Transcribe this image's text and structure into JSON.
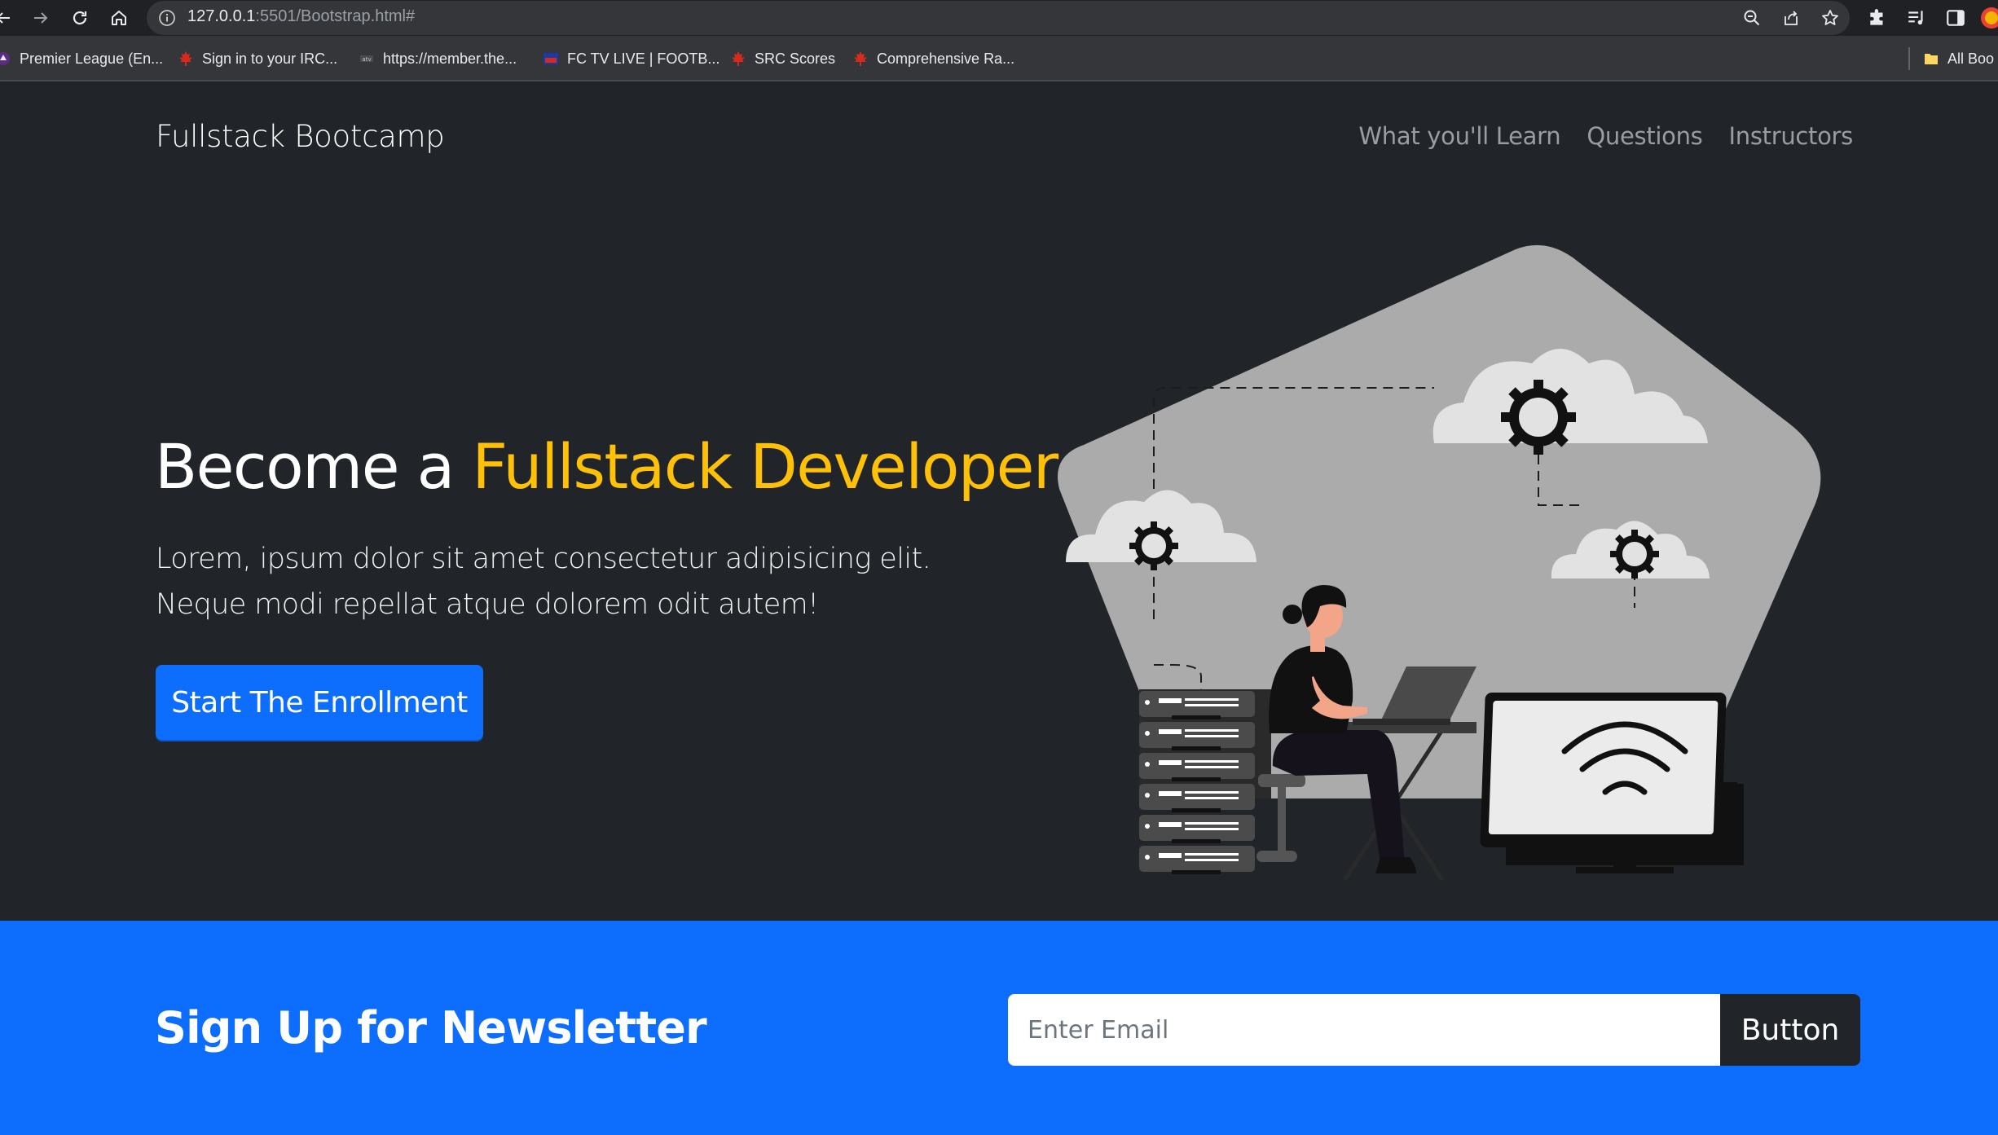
{
  "browser": {
    "url_host": "127.0.0.1",
    "url_path": ":5501/Bootstrap.html#",
    "bookmarks": [
      {
        "label": "Premier League (En..."
      },
      {
        "label": "Sign in to your IRC..."
      },
      {
        "label": "https://member.the..."
      },
      {
        "label": "FC TV LIVE | FOOTB..."
      },
      {
        "label": "SRC Scores"
      },
      {
        "label": "Comprehensive Ra..."
      }
    ],
    "all_bookmarks_label": "All Boo"
  },
  "navbar": {
    "brand": "Fullstack Bootcamp",
    "links": [
      {
        "label": "What you'll Learn"
      },
      {
        "label": "Questions"
      },
      {
        "label": "Instructors"
      }
    ]
  },
  "hero": {
    "title_prefix": "Become a ",
    "title_accent": "Fullstack Developer",
    "text": "Lorem, ipsum dolor sit amet consectetur adipisicing elit. Neque modi repellat atque dolorem odit autem!",
    "cta_label": "Start The Enrollment"
  },
  "newsletter": {
    "title": "Sign Up for Newsletter",
    "email_placeholder": "Enter Email",
    "button_label": "Button"
  },
  "colors": {
    "page_bg": "#212529",
    "accent_yellow": "#ffc107",
    "primary_blue": "#0d6efd",
    "illustration_shape": "#ababab"
  }
}
